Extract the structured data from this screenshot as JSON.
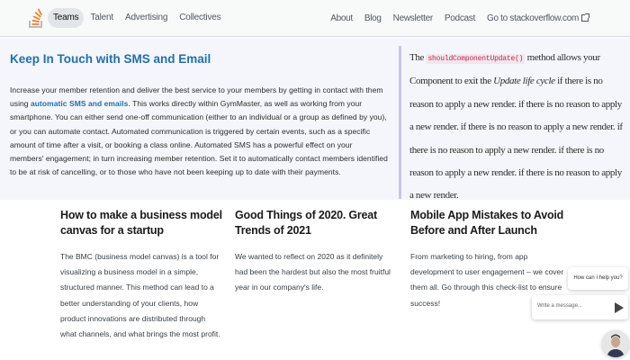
{
  "nav": {
    "tabs": [
      "Teams",
      "Talent",
      "Advertising",
      "Collectives"
    ],
    "active_tab": "Teams",
    "links": [
      "About",
      "Blog",
      "Newsletter",
      "Podcast"
    ],
    "external_link": "Go to stackoverflow.com"
  },
  "hero": {
    "title": "Keep In Touch with SMS and Email",
    "body_pre": "Increase your member retention and deliver the best service to your members by getting in contact with them using ",
    "body_highlight": "automatic SMS and emails",
    "body_post": ". This works directly within GymMaster, as well as working from your smartphone. You can either send one-off communication (either to an individual or a group as defined by you), or you can automate contact. Automated communication is triggered by certain events, such as a specific amount of time after a visit, or booking a class online. Automated SMS has a powerful effect on your members' engagement; in turn increasing member retention. Set it to automatically contact members identified to be at risk of cancelling, or to those who have not been keeping up to date with their payments."
  },
  "quote": {
    "pre": "The ",
    "code": "shouldComponentUpdate()",
    "mid": " method allows your Component to exit the ",
    "em": "Update life cycle",
    "post": " if there is no reason to apply a new render. if there is no reason to apply a new render. if there is no reason to apply a new render. if there is no reason to apply a new render. if there is no reason to apply a new render. if there is no reason to apply a new render."
  },
  "articles": [
    {
      "title": "How to make a business model canvas for a startup",
      "body": "The BMC (business model canvas) is a tool for visualizing a business model in a simple, structured manner. This method can lead to a better understanding of your clients, how product innovations are distributed through what channels, and what brings the most profit."
    },
    {
      "title": "Good Things of 2020. Great Trends of 2021",
      "body": "We wanted to reflect on 2020 as it definitely had been the hardest but also the most fruitful year in our company's life."
    },
    {
      "title": "Mobile App Mistakes to Avoid Before and After Launch",
      "body": "From marketing to hiring, from app development to user engagement – we cover them all. Go through this check-list to ensure success!"
    }
  ],
  "chat": {
    "bubble": "How can I help you?",
    "placeholder": "Write a message..."
  },
  "colors": {
    "accent": "#1f6fb2",
    "logo_orange": "#f48024",
    "quote_border": "#c9c4e6",
    "code": "#c7254e"
  }
}
